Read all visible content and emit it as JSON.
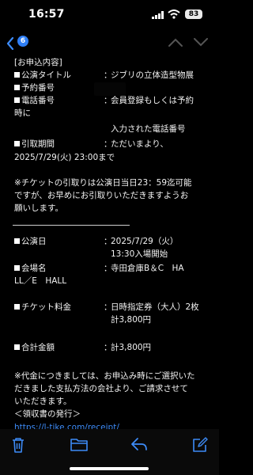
{
  "status_bar": {
    "time": "16:57",
    "battery": "83"
  },
  "nav": {
    "unread_count": "6"
  },
  "email": {
    "section_header": "[お申込内容]",
    "fields": {
      "performance_title": {
        "label": "公演タイトル",
        "colon": "：",
        "value": "ジブリの立体造型物展"
      },
      "reservation_number": {
        "label": "予約番号"
      },
      "phone_number": {
        "label": "電話番号",
        "colon": "：",
        "value_line1": "会員登録もしくは予約",
        "value_line2": "時に",
        "value_line3": "入力された電話番号"
      },
      "pickup_period": {
        "label": "引取期間",
        "colon": "：",
        "value_line1": "ただいまより、",
        "value_line2": "2025/7/29(火) 23:00まで"
      }
    },
    "note_pickup": [
      "※チケットの引取りは公演日当日23：59迄可能",
      "ですが、お早めにお引取りいただきますようお",
      "願いします。"
    ],
    "performance_date": {
      "label": "公演日",
      "colon": "：",
      "value_line1": "2025/7/29（火）",
      "value_line2": "13:30入場開始"
    },
    "venue": {
      "label": "会場名",
      "colon": "：",
      "value_line1": "寺田倉庫B＆C　HA",
      "value_line2": "LL／E　HALL"
    },
    "ticket_price": {
      "label": "チケット料金",
      "colon": "：",
      "value_line1": "日時指定券（大人）2枚",
      "value_line2": "計3,800円"
    },
    "total_amount": {
      "label": "合計金額",
      "colon": "：",
      "value": "計3,800円"
    },
    "note_payment": [
      "※代金につきましては、お申込み時にご選択いた",
      "だきました支払方法の会社より、ご請求させて",
      "いただきます。"
    ],
    "receipt_header": "＜領収書の発行＞",
    "receipt_link": "https://l-tike.com/receipt/"
  },
  "colors": {
    "accent": "#2f7ff6",
    "background": "#000000",
    "text": "#f2f2f2"
  },
  "icons": {
    "back": "chevron-left-icon",
    "prev": "chevron-up-icon",
    "next": "chevron-down-icon",
    "toolbar": [
      "trash-icon",
      "folder-icon",
      "reply-icon",
      "compose-icon"
    ]
  }
}
